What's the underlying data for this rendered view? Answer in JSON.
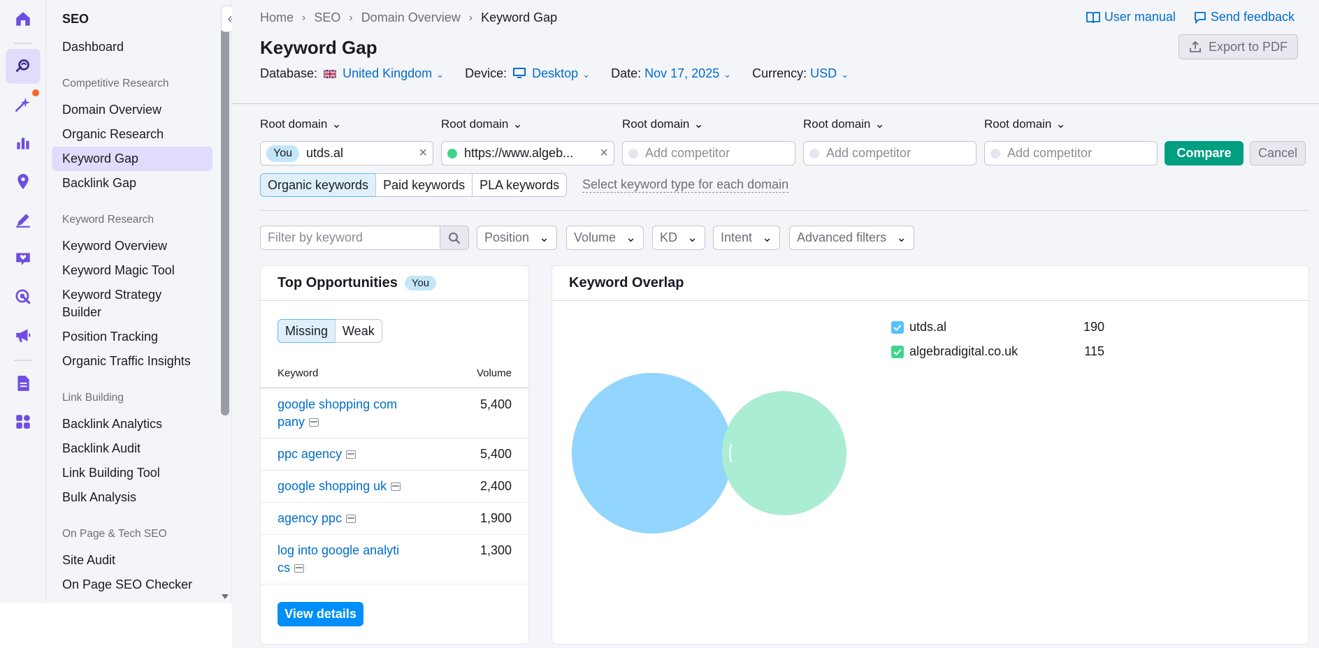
{
  "rail": {
    "icons": [
      "home-icon",
      "seo-icon",
      "ai-sparkle-icon",
      "bar-chart-icon",
      "location-pin-icon",
      "content-pen-icon",
      "social-heart-icon",
      "traffic-target-icon",
      "megaphone-icon",
      "reports-icon",
      "apps-grid-icon"
    ],
    "accent": "#6e4ee1",
    "notification_color": "#ff642d"
  },
  "sidebar": {
    "title": "SEO",
    "dashboard": "Dashboard",
    "groups": [
      {
        "label": "Competitive Research",
        "items": [
          "Domain Overview",
          "Organic Research",
          "Keyword Gap",
          "Backlink Gap"
        ]
      },
      {
        "label": "Keyword Research",
        "items": [
          "Keyword Overview",
          "Keyword Magic Tool",
          "Keyword Strategy Builder",
          "Position Tracking",
          "Organic Traffic Insights"
        ]
      },
      {
        "label": "Link Building",
        "items": [
          "Backlink Analytics",
          "Backlink Audit",
          "Link Building Tool",
          "Bulk Analysis"
        ]
      },
      {
        "label": "On Page & Tech SEO",
        "items": [
          "Site Audit",
          "On Page SEO Checker"
        ]
      }
    ],
    "active_item": "Keyword Gap"
  },
  "breadcrumb": [
    "Home",
    "SEO",
    "Domain Overview",
    "Keyword Gap"
  ],
  "top_links": {
    "manual": "User manual",
    "feedback": "Send feedback"
  },
  "page_title": "Keyword Gap",
  "export_label": "Export to PDF",
  "settings": {
    "database_label": "Database:",
    "database_value": "United Kingdom",
    "device_label": "Device:",
    "device_value": "Desktop",
    "date_label": "Date:",
    "date_value": "Nov 17, 2025",
    "currency_label": "Currency:",
    "currency_value": "USD"
  },
  "domains": {
    "root_label": "Root domain",
    "you_badge": "You",
    "you_value": "utds.al",
    "competitor_value": "https://www.algeb...",
    "add_placeholder": "Add competitor",
    "compare": "Compare",
    "cancel": "Cancel"
  },
  "keyword_types": {
    "tabs": [
      "Organic keywords",
      "Paid keywords",
      "PLA keywords"
    ],
    "active": "Organic keywords",
    "link": "Select keyword type for each domain"
  },
  "filters": {
    "placeholder": "Filter by keyword",
    "dropdowns": [
      "Position",
      "Volume",
      "KD",
      "Intent",
      "Advanced filters"
    ]
  },
  "top_opportunities": {
    "title": "Top Opportunities",
    "badge": "You",
    "segments": [
      "Missing",
      "Weak"
    ],
    "active_segment": "Missing",
    "col_keyword": "Keyword",
    "col_volume": "Volume",
    "rows": [
      {
        "keyword": "google shopping com pany",
        "volume": "5,400"
      },
      {
        "keyword": "ppc agency",
        "volume": "5,400"
      },
      {
        "keyword": "google shopping uk",
        "volume": "2,400"
      },
      {
        "keyword": "agency ppc",
        "volume": "1,900"
      },
      {
        "keyword": "log into google analyti cs",
        "volume": "1,300"
      }
    ],
    "view_details": "View details"
  },
  "keyword_overlap": {
    "title": "Keyword Overlap",
    "series": [
      {
        "name": "utds.al",
        "count": "190",
        "color": "#56c1ff",
        "fill": "#92d5fd"
      },
      {
        "name": "algebradigital.co.uk",
        "count": "115",
        "color": "#3dd68c",
        "fill": "#abedd2"
      }
    ]
  }
}
